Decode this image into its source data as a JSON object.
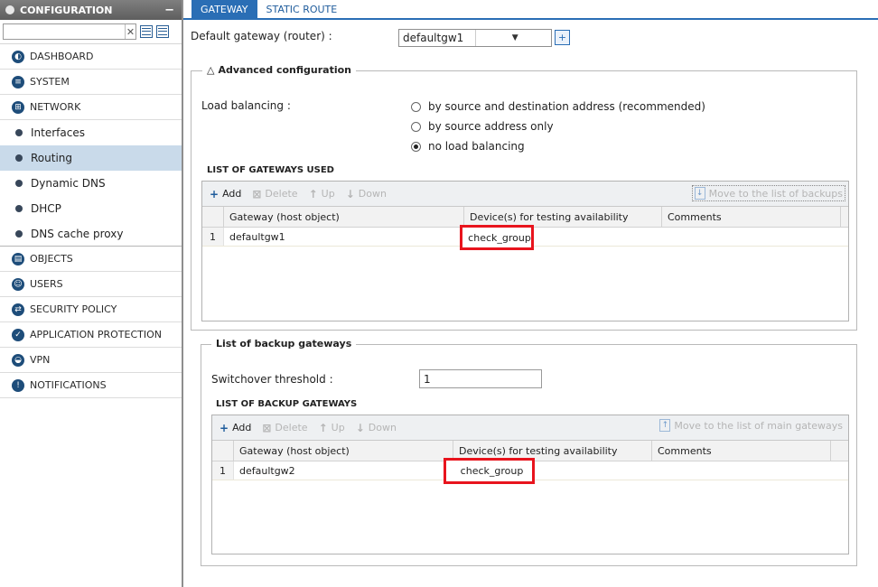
{
  "sidebar": {
    "title": "CONFIGURATION",
    "collapse_symbol": "−",
    "search": {
      "value": "",
      "placeholder": ""
    },
    "items": [
      {
        "label": "DASHBOARD",
        "icon": "dashboard-icon"
      },
      {
        "label": "SYSTEM",
        "icon": "system-icon"
      },
      {
        "label": "NETWORK",
        "icon": "network-icon"
      }
    ],
    "network_subitems": [
      "Interfaces",
      "Routing",
      "Dynamic DNS",
      "DHCP",
      "DNS cache proxy"
    ],
    "active_subitem": "Routing",
    "items_after": [
      {
        "label": "OBJECTS",
        "icon": "objects-icon"
      },
      {
        "label": "USERS",
        "icon": "users-icon"
      },
      {
        "label": "SECURITY POLICY",
        "icon": "security-policy-icon"
      },
      {
        "label": "APPLICATION PROTECTION",
        "icon": "application-protection-icon"
      },
      {
        "label": "VPN",
        "icon": "vpn-icon"
      },
      {
        "label": "NOTIFICATIONS",
        "icon": "notifications-icon"
      }
    ]
  },
  "tabs": [
    "GATEWAY",
    "STATIC ROUTE"
  ],
  "active_tab": "GATEWAY",
  "default_gateway": {
    "label": "Default gateway (router) :",
    "value": "defaultgw1"
  },
  "advanced": {
    "title": "Advanced configuration",
    "load_balancing_label": "Load balancing :",
    "options": [
      {
        "label": "by source and destination address (recommended)",
        "selected": false
      },
      {
        "label": "by source address only",
        "selected": false
      },
      {
        "label": "no load balancing",
        "selected": true
      }
    ],
    "gateways_title": "LIST OF GATEWAYS USED",
    "toolbar": {
      "add": "Add",
      "delete": "Delete",
      "up": "Up",
      "down": "Down",
      "move": "Move to the list of backups"
    },
    "columns": [
      "Gateway (host object)",
      "Device(s) for testing availability",
      "Comments"
    ],
    "rows": [
      {
        "num": "1",
        "gateway": "defaultgw1",
        "device": "check_group",
        "comments": ""
      }
    ]
  },
  "backup": {
    "title": "List of backup gateways",
    "threshold_label": "Switchover threshold :",
    "threshold_value": "1",
    "list_title": "LIST OF BACKUP GATEWAYS",
    "toolbar": {
      "add": "Add",
      "delete": "Delete",
      "up": "Up",
      "down": "Down",
      "move": "Move to the list of main gateways"
    },
    "columns": [
      "Gateway (host object)",
      "Device(s) for testing availability",
      "Comments"
    ],
    "rows": [
      {
        "num": "1",
        "gateway": "defaultgw2",
        "device": "check_group",
        "comments": ""
      }
    ]
  },
  "colors": {
    "accent": "#2a6eb5",
    "highlight": "#e8141d",
    "active_row": "#c9daea"
  }
}
